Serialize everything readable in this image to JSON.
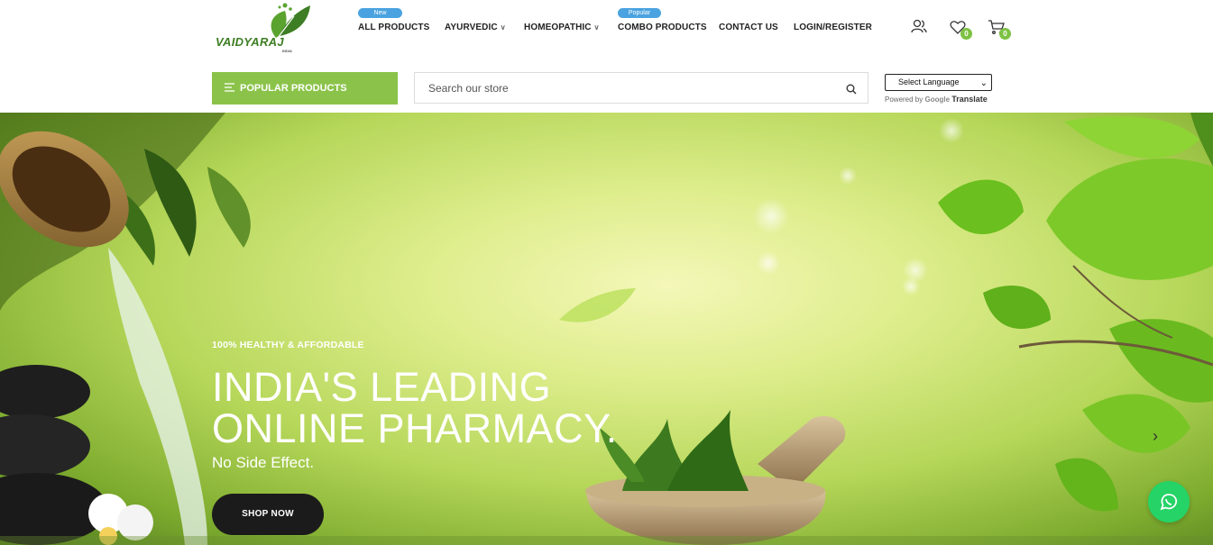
{
  "brand": {
    "name": "VAIDYARAJ",
    "sub": "INDIA",
    "color": "#3d7d23"
  },
  "nav": {
    "items": [
      {
        "label": "ALL PRODUCTS",
        "badge": "New"
      },
      {
        "label": "AYURVEDIC",
        "dropdown": true
      },
      {
        "label": "HOMEOPATHIC",
        "dropdown": true
      },
      {
        "label": "COMBO PRODUCTS",
        "badge": "Popular"
      },
      {
        "label": "CONTACT US"
      },
      {
        "label": "LOGIN/REGISTER"
      }
    ]
  },
  "header_icons": {
    "account": "user-icon",
    "wishlist": {
      "icon": "heart-icon",
      "count": "0"
    },
    "cart": {
      "icon": "cart-icon",
      "count": "0"
    }
  },
  "toolbar": {
    "popular_label": "POPULAR PRODUCTS",
    "search_placeholder": "Search our store",
    "language_label": "Select Language",
    "powered_by": "Powered by",
    "google": "Google",
    "translate": "Translate"
  },
  "hero": {
    "tagline": "100% HEALTHY & AFFORDABLE",
    "title_line1": "INDIA'S LEADING",
    "title_line2": "ONLINE PHARMACY.",
    "subtitle": "No Side Effect.",
    "cta": "SHOP NOW"
  },
  "colors": {
    "accent": "#8bc34a",
    "badge": "#4aa3e0",
    "count": "#7dc243",
    "whatsapp": "#25d366",
    "cta": "#1b1b1b"
  }
}
